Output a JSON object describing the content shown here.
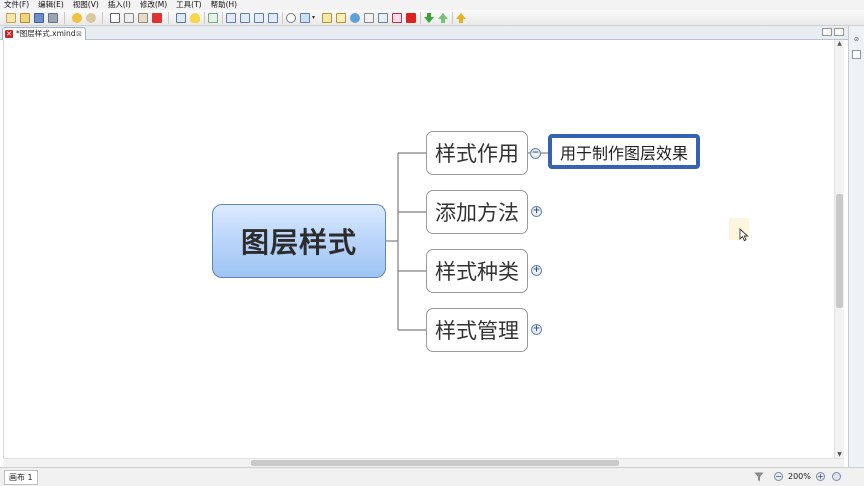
{
  "menubar": {
    "items": [
      "文件(F)",
      "编辑(E)",
      "视图(V)",
      "插入(I)",
      "修改(M)",
      "工具(T)",
      "帮助(H)"
    ]
  },
  "tab": {
    "title": "*图层样式.xmind",
    "close_glyph": "⊠",
    "icon": "xmind-file-icon"
  },
  "mindmap": {
    "central_topic": "图层样式",
    "topics": [
      {
        "label": "样式作用",
        "state": "expanded",
        "expander_glyph": "−"
      },
      {
        "label": "添加方法",
        "state": "collapsed",
        "expander_glyph": "+"
      },
      {
        "label": "样式种类",
        "state": "collapsed",
        "expander_glyph": "+"
      },
      {
        "label": "样式管理",
        "state": "collapsed",
        "expander_glyph": "+"
      }
    ],
    "subtopic": "用于制作图层效果",
    "colors": {
      "central_fill": "#bcd6fb",
      "central_border": "#5f86b7",
      "selected_border": "#3562b5",
      "connector": "#808080"
    }
  },
  "statusbar": {
    "sheet": "画布 1",
    "zoom": "200%",
    "zoom_out": "−",
    "zoom_in": "+"
  },
  "icons": {
    "filter": "filter-icon",
    "side_panel": [
      "pin-icon",
      "panel-icon"
    ]
  }
}
